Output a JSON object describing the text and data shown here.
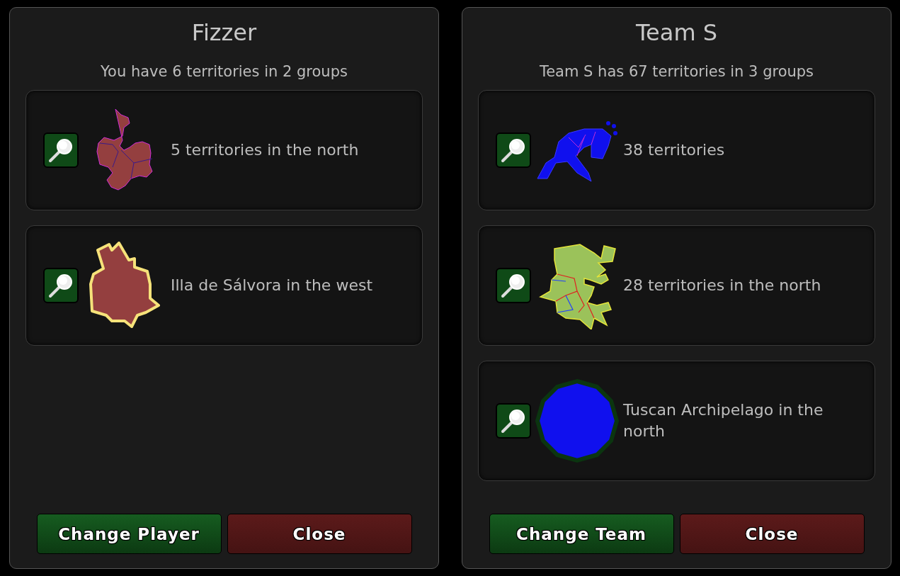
{
  "panels": [
    {
      "title": "Fizzer",
      "summary": "You have 6 territories in 2 groups",
      "groups": [
        {
          "kind": "red-regions",
          "label": "5 territories in the north"
        },
        {
          "kind": "red-island",
          "label": "Illa de Sálvora in the west"
        }
      ],
      "buttons": [
        {
          "label": "Change Player",
          "kind": "green"
        },
        {
          "label": "Close",
          "kind": "red"
        }
      ]
    },
    {
      "title": "Team S",
      "summary": "Team S has 67 territories in 3 groups",
      "groups": [
        {
          "kind": "blue-regions",
          "label": "38 territories"
        },
        {
          "kind": "green-regions",
          "label": "28 territories in the north"
        },
        {
          "kind": "blue-disc",
          "label": "Tuscan Archipelago in the north"
        }
      ],
      "buttons": [
        {
          "label": "Change Team",
          "kind": "green"
        },
        {
          "label": "Close",
          "kind": "red"
        }
      ]
    }
  ]
}
